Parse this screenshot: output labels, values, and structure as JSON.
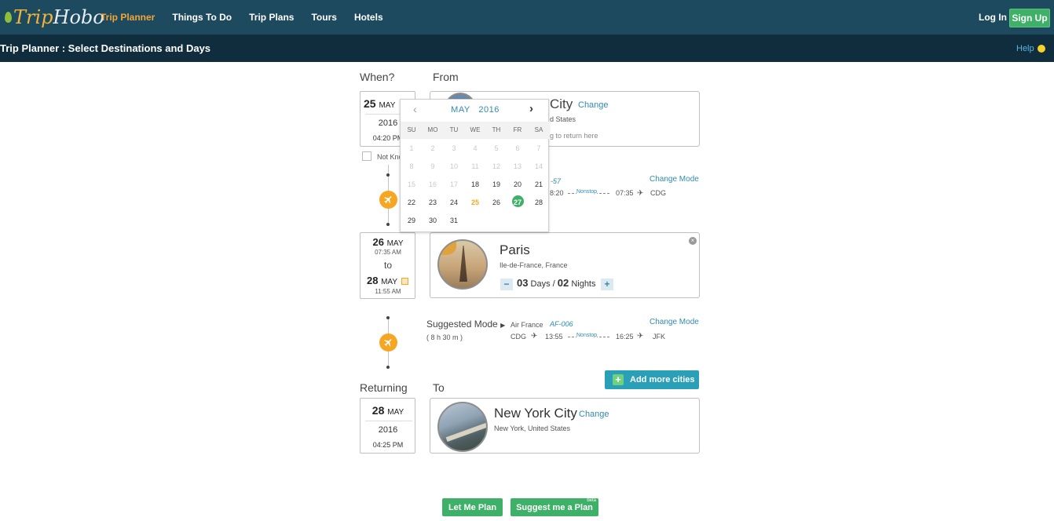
{
  "brand": {
    "part1": "Trip",
    "part2": "Hobo"
  },
  "nav": {
    "items": [
      "Trip Planner",
      "Things To Do",
      "Trip Plans",
      "Tours",
      "Hotels"
    ],
    "login": "Log In",
    "signup": "Sign Up"
  },
  "subbar": {
    "title": "Trip Planner : Select Destinations and Days",
    "help": "Help"
  },
  "labels": {
    "when": "When?",
    "from": "From",
    "returning": "Returning",
    "to": "To"
  },
  "start": {
    "day": "25",
    "month": "MAY",
    "year": "2016",
    "time": "04:20 PM",
    "not_known": "Not Kno"
  },
  "from_city": {
    "name": "City",
    "change": "Change",
    "country": "d States",
    "hint": "g to return here"
  },
  "calendar": {
    "month": "MAY",
    "year": "2016",
    "dow": [
      "SU",
      "MO",
      "TU",
      "WE",
      "TH",
      "FR",
      "SA"
    ],
    "rows": [
      [
        "1",
        "2",
        "3",
        "4",
        "5",
        "6",
        "7"
      ],
      [
        "8",
        "9",
        "10",
        "11",
        "12",
        "13",
        "14"
      ],
      [
        "15",
        "16",
        "17",
        "18",
        "19",
        "20",
        "21"
      ],
      [
        "22",
        "23",
        "24",
        "25",
        "26",
        "27",
        "28"
      ],
      [
        "29",
        "30",
        "31",
        "",
        "",
        "",
        ""
      ]
    ],
    "today": "25",
    "selected": "27",
    "first_enabled": "18"
  },
  "leg1": {
    "flight_tail": "-57",
    "change_mode": "Change Mode",
    "dep_time": "8:20",
    "nonstop": "Nonstop",
    "arr_time": "07:35",
    "arr_code": "CDG"
  },
  "paris_dates": {
    "from_day": "26",
    "from_month": "MAY",
    "from_time": "07:35 AM",
    "to": "to",
    "to_day": "28",
    "to_month": "MAY",
    "to_time": "11:55 AM"
  },
  "paris": {
    "name": "Paris",
    "region": "Ile-de-France, France",
    "days": "03",
    "days_label": "Days /",
    "nights": "02",
    "nights_label": "Nights",
    "minus": "−",
    "plus": "+"
  },
  "leg2": {
    "suggested": "Suggested Mode",
    "duration": "( 8 h 30 m )",
    "airline": "Air France",
    "flight": "AF-006",
    "change_mode": "Change Mode",
    "dep_code": "CDG",
    "dep_time": "13:55",
    "nonstop": "Nonstop",
    "arr_time": "16:25",
    "arr_code": "JFK"
  },
  "add_more": "Add more cities",
  "return": {
    "day": "28",
    "month": "MAY",
    "year": "2016",
    "time": "04:25 PM"
  },
  "to_city": {
    "name": "New York City",
    "change": "Change",
    "region": "New York, United States"
  },
  "actions": {
    "let_me_plan": "Let Me Plan",
    "suggest": "Suggest me a Plan",
    "beta": "beta"
  }
}
